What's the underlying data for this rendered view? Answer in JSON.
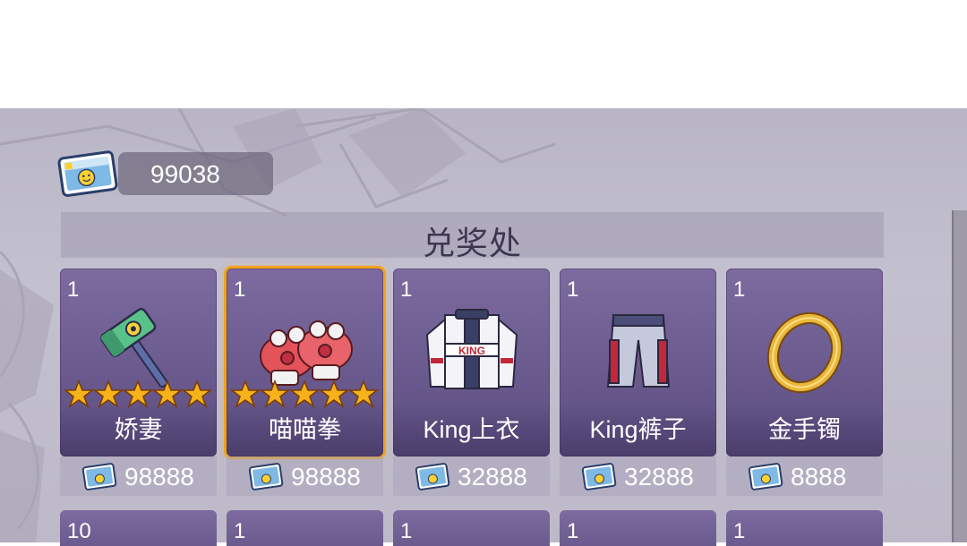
{
  "currency": {
    "icon": "ticket-icon",
    "amount": "99038"
  },
  "shop": {
    "title": "兑奖处"
  },
  "items_row1": [
    {
      "qty": "1",
      "name": "娇妻",
      "price": "98888",
      "stars": 5,
      "icon": "hammer-icon",
      "selected": false
    },
    {
      "qty": "1",
      "name": "喵喵拳",
      "price": "98888",
      "stars": 5,
      "icon": "paw-gloves-icon",
      "selected": true
    },
    {
      "qty": "1",
      "name": "King上衣",
      "price": "32888",
      "stars": 0,
      "icon": "racing-jacket-icon",
      "selected": false
    },
    {
      "qty": "1",
      "name": "King裤子",
      "price": "32888",
      "stars": 0,
      "icon": "racing-pants-icon",
      "selected": false
    },
    {
      "qty": "1",
      "name": "金手镯",
      "price": "8888",
      "stars": 0,
      "icon": "gold-bracelet-icon",
      "selected": false
    }
  ],
  "items_row2": [
    {
      "qty": "10"
    },
    {
      "qty": "1"
    },
    {
      "qty": "1"
    },
    {
      "qty": "1"
    },
    {
      "qty": "1"
    }
  ],
  "colors": {
    "card_purple": "#6a5a8d",
    "selected_border": "#f0a21c",
    "star_gold": "#f6b21a"
  }
}
